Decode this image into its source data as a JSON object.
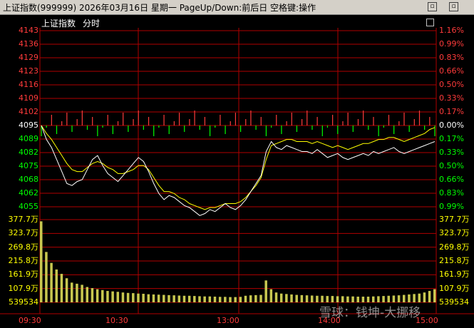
{
  "titlebar": {
    "text": "上证指数(999999)  2026年03月16日 星期一  PageUp/Down:前后日 空格键:操作"
  },
  "panel": {
    "name": "上证指数",
    "period": "分时"
  },
  "price_axis": {
    "left": [
      "4143",
      "4136",
      "4129",
      "4123",
      "4116",
      "4109",
      "4102",
      "4095",
      "4089",
      "4082",
      "4075",
      "4068",
      "4062",
      "4055"
    ],
    "right": [
      "1.16%",
      "0.99%",
      "0.83%",
      "0.66%",
      "0.50%",
      "0.33%",
      "0.17%",
      "0.00%",
      "0.17%",
      "0.33%",
      "0.50%",
      "0.66%",
      "0.83%",
      "0.99%"
    ]
  },
  "volume_axis": {
    "labels": [
      "377.7万",
      "323.7万",
      "269.8万",
      "215.8万",
      "161.9万",
      "107.9万",
      "539534"
    ]
  },
  "time_axis": [
    "09:30",
    "10:30",
    "13:00",
    "14:00",
    "15:00"
  ],
  "watermark": "雪球：钱坤-大挪移",
  "colors": {
    "up": "#ff3b3b",
    "down": "#00ff00",
    "grid": "#b00000",
    "line_index": "#ffffff",
    "line_avg": "#ffff00",
    "volume": "#c8c850",
    "zero_label": "#ffffff"
  },
  "chart_data": {
    "type": "line",
    "title": "上证指数 分时",
    "prev_close": 4095,
    "ylim": [
      4051,
      4145
    ],
    "x_sessions": [
      "09:30",
      "10:30",
      "13:00",
      "14:00",
      "15:00"
    ],
    "series": [
      {
        "name": "index",
        "values": [
          4095,
          4088,
          4084,
          4078,
          4072,
          4066,
          4065,
          4067,
          4068,
          4073,
          4078,
          4080,
          4075,
          4071,
          4069,
          4067,
          4070,
          4073,
          4076,
          4079,
          4077,
          4072,
          4066,
          4061,
          4058,
          4060,
          4059,
          4057,
          4055,
          4054,
          4052,
          4050,
          4051,
          4053,
          4052,
          4054,
          4056,
          4054,
          4053,
          4055,
          4058,
          4062,
          4066,
          4070,
          4082,
          4087,
          4084,
          4083,
          4085,
          4084,
          4083,
          4082,
          4082,
          4081,
          4083,
          4081,
          4079,
          4080,
          4081,
          4079,
          4078,
          4079,
          4080,
          4081,
          4080,
          4082,
          4081,
          4082,
          4083,
          4084,
          4082,
          4081,
          4082,
          4083,
          4084,
          4085,
          4086,
          4087
        ]
      },
      {
        "name": "avg",
        "values": [
          4095,
          4091,
          4088,
          4084,
          4080,
          4076,
          4073,
          4072,
          4072,
          4074,
          4076,
          4077,
          4076,
          4074,
          4073,
          4071,
          4071,
          4072,
          4073,
          4075,
          4075,
          4073,
          4069,
          4065,
          4062,
          4062,
          4061,
          4059,
          4058,
          4056,
          4055,
          4054,
          4053,
          4054,
          4054,
          4055,
          4056,
          4056,
          4056,
          4057,
          4059,
          4062,
          4065,
          4069,
          4078,
          4085,
          4086,
          4087,
          4088,
          4088,
          4087,
          4087,
          4087,
          4086,
          4087,
          4086,
          4085,
          4084,
          4085,
          4084,
          4083,
          4084,
          4085,
          4086,
          4086,
          4087,
          4088,
          4088,
          4089,
          4089,
          4088,
          4087,
          4088,
          4089,
          4090,
          4091,
          4093,
          4094
        ]
      }
    ],
    "volume_max": 3777000,
    "volume": [
      3700000,
      2300000,
      1800000,
      1500000,
      1300000,
      1100000,
      900000,
      850000,
      800000,
      700000,
      650000,
      600000,
      560000,
      520000,
      500000,
      480000,
      450000,
      430000,
      420000,
      400000,
      390000,
      370000,
      360000,
      350000,
      340000,
      330000,
      320000,
      310000,
      300000,
      300000,
      290000,
      280000,
      270000,
      270000,
      260000,
      250000,
      250000,
      240000,
      240000,
      250000,
      300000,
      320000,
      330000,
      340000,
      1000000,
      600000,
      450000,
      400000,
      380000,
      360000,
      340000,
      330000,
      320000,
      310000,
      300000,
      300000,
      290000,
      290000,
      280000,
      280000,
      270000,
      270000,
      260000,
      260000,
      260000,
      270000,
      280000,
      290000,
      300000,
      310000,
      320000,
      340000,
      360000,
      380000,
      400000,
      450000,
      520000,
      600000
    ]
  }
}
